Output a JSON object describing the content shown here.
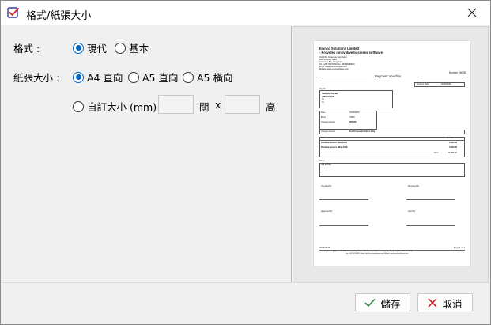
{
  "window": {
    "title": "格式/紙張大小"
  },
  "format": {
    "label": "格式 :",
    "options": [
      {
        "label": "現代",
        "checked": true
      },
      {
        "label": "基本",
        "checked": false
      }
    ]
  },
  "paper_size": {
    "label": "紙張大小 :",
    "options": [
      {
        "label": "A4 直向",
        "checked": true
      },
      {
        "label": "A5 直向",
        "checked": false
      },
      {
        "label": "A5 橫向",
        "checked": false
      }
    ],
    "custom": {
      "label": "自訂大小 (mm)",
      "checked": false,
      "width_label": "闊",
      "x_label": "x",
      "height_label": "高",
      "width_value": "",
      "height_value": ""
    }
  },
  "preview": {
    "company": "Evinco Solutions Limited",
    "tagline": "- Provides innovative business software",
    "address_lines": [
      "Unit 1303 Causeway Bay Plaza I",
      "489 Hennessy Road",
      "Causeway Bay, Hong Kong",
      "Tel : +852 39276669  Fax: +852 96298659",
      "Email: info@evincesoftware.com",
      "Website: www.evincesoftware.com"
    ],
    "number_line": "Number 16008",
    "doc_title": "Payment Voucher",
    "voucher_date_label": "Voucher Date",
    "voucher_date": "2018/08/05",
    "pay_to_label": "Pay To",
    "payee_lines": [
      "Sample Payee",
      "ABC ROAD",
      "Xx",
      "Xx"
    ],
    "fields": [
      {
        "k": "Date",
        "v": "2018/08/05"
      },
      {
        "k": "Bank",
        "v": "HSBC"
      },
      {
        "k": "Cheque Number",
        "v": "387188"
      },
      {
        "k": "Cheque Amount",
        "v": "Ten Thousand Dollars Only"
      }
    ],
    "items_header": {
      "item": "Item",
      "amount": "Amount"
    },
    "items": [
      {
        "desc": "Reimbursement - Apr 2018",
        "amount": "5,000.00"
      },
      {
        "desc": "Reimbursement - May 2018",
        "amount": "5,000.00"
      }
    ],
    "total_label": "Total",
    "total": "10,000.00",
    "notes_label": "Notes",
    "notes_text": "Ask to relay",
    "signatures": [
      "Checked By",
      "Received By",
      "Approved By",
      "Input By"
    ],
    "footer_date": "2018/08/05",
    "page_label": "Page 1 of 1",
    "footer_line1": "Address: Unit 1303 Causeway Bay Plaza I, 489 Hennessy Road, Causeway Bay, Hong Kong  Tel: +852 39276669",
    "footer_line2": "Fax: +852 96298659  Email: info@evincesoftware.com  Website: www.evincesoftware.com"
  },
  "buttons": {
    "save": "儲存",
    "cancel": "取消"
  },
  "colors": {
    "accent": "#0067c0",
    "save_check": "#2e8b3d",
    "cancel_x": "#d42020"
  }
}
